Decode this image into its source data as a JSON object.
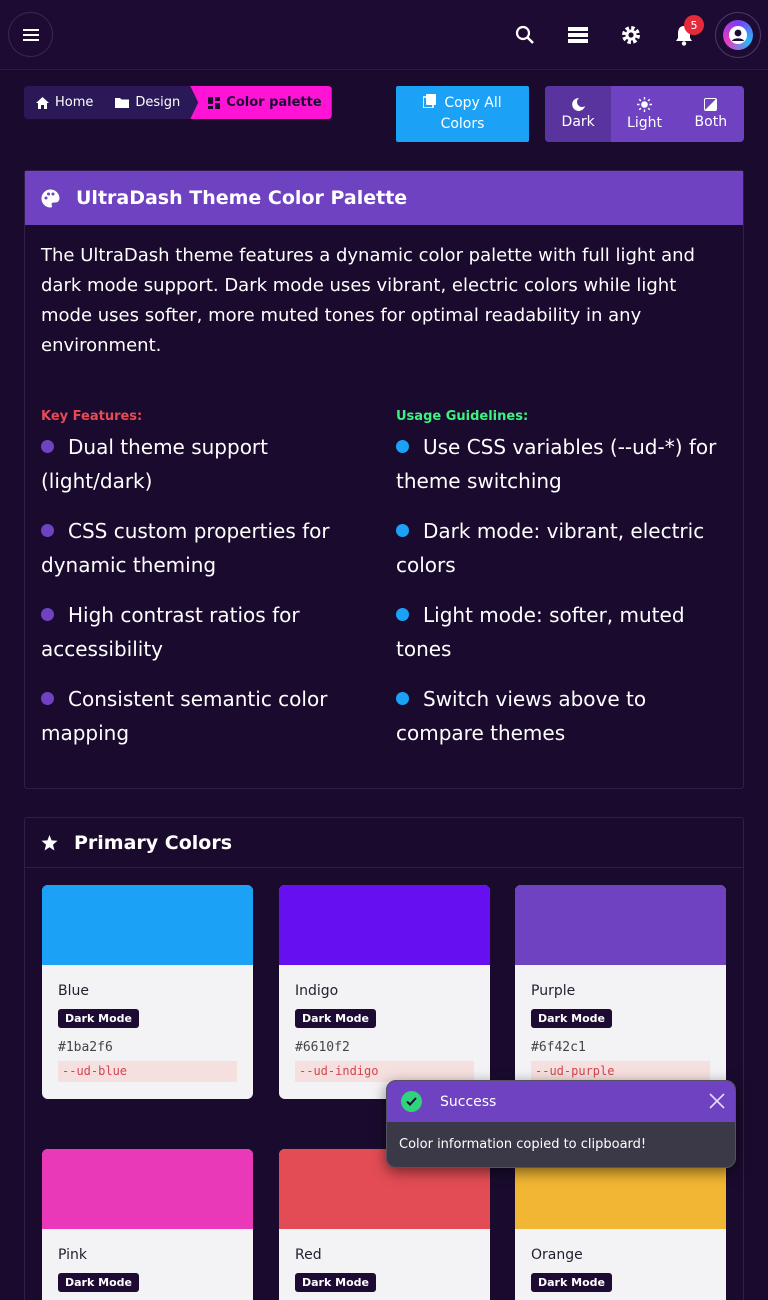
{
  "header": {
    "notification_count": "5",
    "icons": [
      "menu-icon",
      "search-icon",
      "layers-icon",
      "gear-icon",
      "bell-icon",
      "avatar"
    ]
  },
  "breadcrumb": [
    {
      "label": "Home",
      "icon": "home-icon"
    },
    {
      "label": "Design",
      "icon": "folder-icon"
    },
    {
      "label": "Color palette",
      "icon": "grid-icon"
    }
  ],
  "toolbar": {
    "copy_label_1": "Copy All",
    "copy_label_2": "Colors",
    "views": [
      {
        "label": "Dark",
        "icon": "moon-icon",
        "active": true
      },
      {
        "label": "Light",
        "icon": "sun-icon",
        "active": false
      },
      {
        "label": "Both",
        "icon": "contrast-icon",
        "active": false
      }
    ]
  },
  "intro": {
    "title": "UltraDash Theme Color Palette",
    "description": "The UltraDash theme features a dynamic color palette with full light and dark mode support. Dark mode uses vibrant, electric colors while light mode uses softer, more muted tones for optimal readability in any environment.",
    "features_title": "Key Features:",
    "features": [
      "Dual theme support (light/dark)",
      "CSS custom properties for dynamic theming",
      "High contrast ratios for accessibility",
      "Consistent semantic color mapping"
    ],
    "guidelines_title": "Usage Guidelines:",
    "guidelines": [
      "Use CSS variables (--ud-*) for theme switching",
      "Dark mode: vibrant, electric colors",
      "Light mode: softer, muted tones",
      "Switch views above to compare themes"
    ]
  },
  "primary": {
    "title": "Primary Colors",
    "swatches": [
      {
        "name": "Blue",
        "mode": "Dark Mode",
        "hex": "#1ba2f6",
        "var": "--ud-blue",
        "color": "#1ba2f6"
      },
      {
        "name": "Indigo",
        "mode": "Dark Mode",
        "hex": "#6610f2",
        "var": "--ud-indigo",
        "color": "#6610f2"
      },
      {
        "name": "Purple",
        "mode": "Dark Mode",
        "hex": "#6f42c1",
        "var": "--ud-purple",
        "color": "#6f42c1"
      },
      {
        "name": "Pink",
        "mode": "Dark Mode",
        "color": "#ea39b8"
      },
      {
        "name": "Red",
        "mode": "Dark Mode",
        "color": "#e44c55"
      },
      {
        "name": "Orange",
        "mode": "Dark Mode",
        "color": "#f1b633"
      }
    ]
  },
  "toast": {
    "title": "Success",
    "message": "Color information copied to clipboard!"
  },
  "colors": {
    "background": "#1a0b2e",
    "accent": "#6f42c1",
    "breadcrumb_active": "#ff14d6",
    "features_title": "#e44c55",
    "guidelines_title": "#3cf281"
  }
}
